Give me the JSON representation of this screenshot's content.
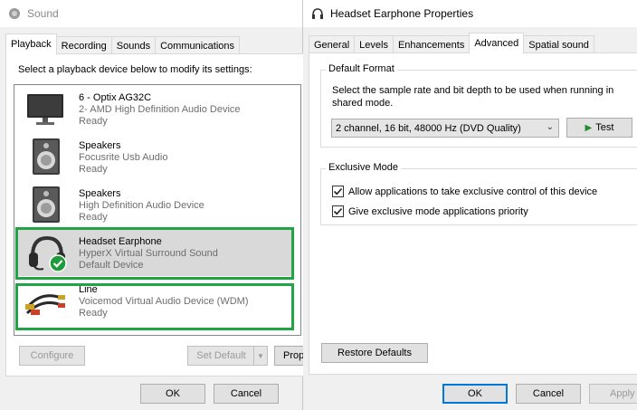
{
  "sound_window": {
    "title": "Sound",
    "tabs": [
      "Playback",
      "Recording",
      "Sounds",
      "Communications"
    ],
    "instruction": "Select a playback device below to modify its settings:",
    "devices": [
      {
        "name": "6 - Optix AG32C",
        "description": "2- AMD High Definition Audio Device",
        "status": "Ready",
        "icon": "monitor-icon"
      },
      {
        "name": "Speakers",
        "description": "Focusrite Usb Audio",
        "status": "Ready",
        "icon": "speaker-icon"
      },
      {
        "name": "Speakers",
        "description": "High Definition Audio Device",
        "status": "Ready",
        "icon": "speaker-icon"
      },
      {
        "name": "Headset Earphone",
        "description": "HyperX Virtual Surround Sound",
        "status": "Default Device",
        "icon": "headset-icon"
      },
      {
        "name": "Line",
        "description": "Voicemod Virtual Audio Device (WDM)",
        "status": "Ready",
        "icon": "audio-cable-icon"
      }
    ],
    "buttons": {
      "configure": "Configure",
      "set_default": "Set Default",
      "properties": "Prop",
      "ok": "OK",
      "cancel": "Cancel"
    }
  },
  "properties_window": {
    "title": "Headset Earphone Properties",
    "tabs": [
      "General",
      "Levels",
      "Enhancements",
      "Advanced",
      "Spatial sound"
    ],
    "default_format": {
      "label": "Default Format",
      "description": "Select the sample rate and bit depth to be used when running in shared mode.",
      "selected": "2 channel, 16 bit, 48000 Hz (DVD Quality)",
      "test_label": "Test"
    },
    "exclusive_mode": {
      "label": "Exclusive Mode",
      "options": [
        {
          "label": "Allow applications to take exclusive control of this device",
          "checked": true
        },
        {
          "label": "Give exclusive mode applications priority",
          "checked": true
        }
      ]
    },
    "buttons": {
      "restore": "Restore Defaults",
      "ok": "OK",
      "cancel": "Cancel",
      "apply": "Apply"
    }
  },
  "colors": {
    "highlight": "#21a544",
    "selection": "#d9d9d9",
    "focus": "#0078d7"
  }
}
